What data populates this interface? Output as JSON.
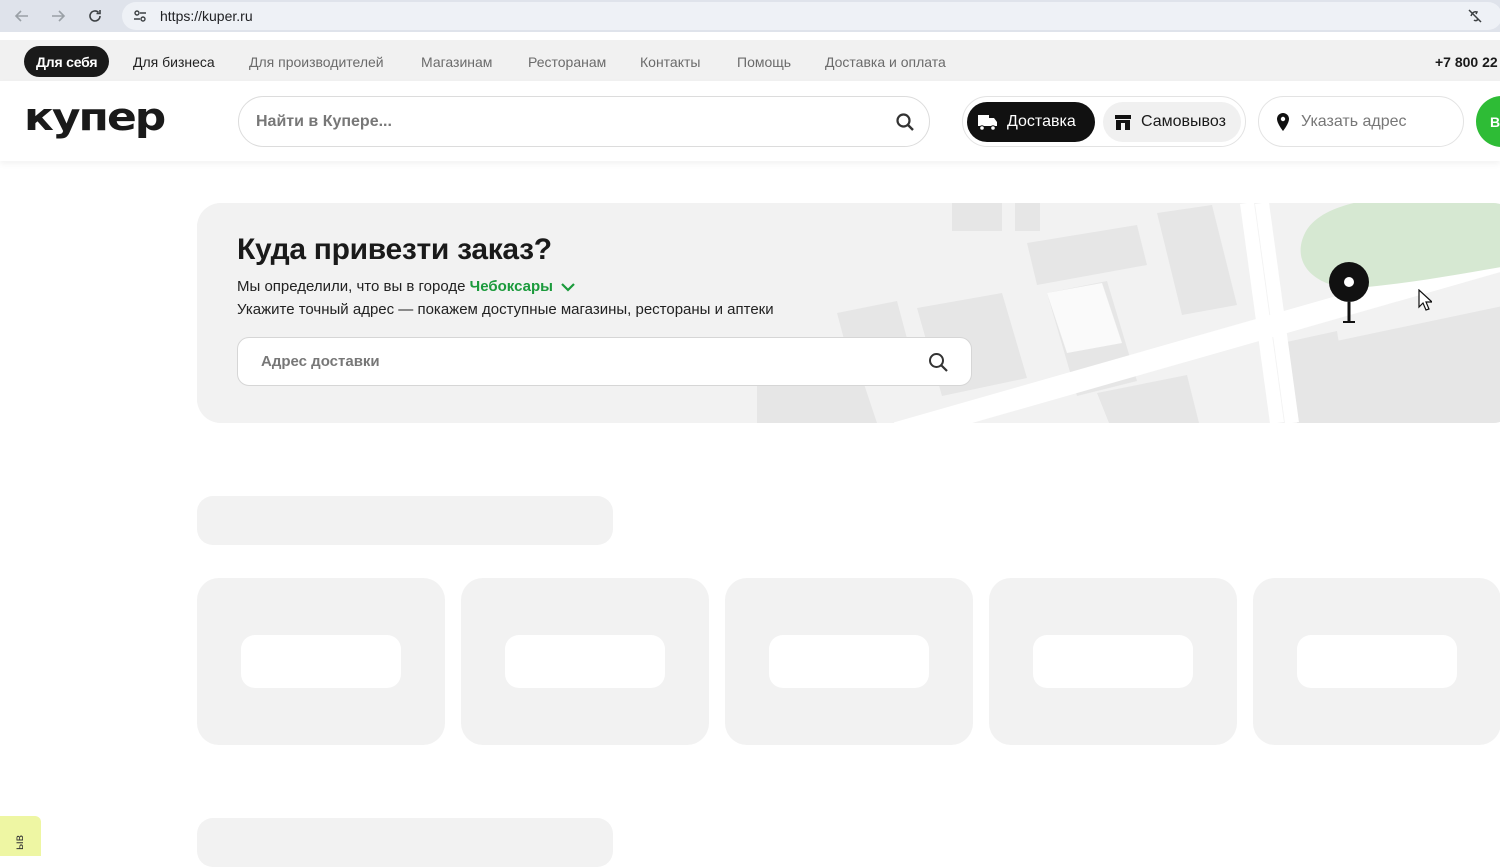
{
  "browser": {
    "url": "https://kuper.ru"
  },
  "topnav": {
    "active_tab": "Для себя",
    "links": [
      "Для бизнеса",
      "Для производителей",
      "Магазинам",
      "Ресторанам",
      "Контакты",
      "Помощь",
      "Доставка и оплата"
    ],
    "phone": "+7 800 22"
  },
  "header": {
    "logo": "купер",
    "search_placeholder": "Найти в Купере...",
    "delivery_label": "Доставка",
    "pickup_label": "Самовывоз",
    "address_label": "Указать адрес",
    "login_label": "В",
    "accent_color": "#2ebc36"
  },
  "hero": {
    "title": "Куда привезти заказ?",
    "detected_prefix": "Мы определили, что вы в городе",
    "city": "Чебоксары",
    "hint": "Укажите точный адрес — покажем доступные магазины, рестораны и аптеки",
    "address_placeholder": "Адрес доставки",
    "city_color": "#1b9a3c"
  },
  "feedback": {
    "label": "ыв"
  }
}
